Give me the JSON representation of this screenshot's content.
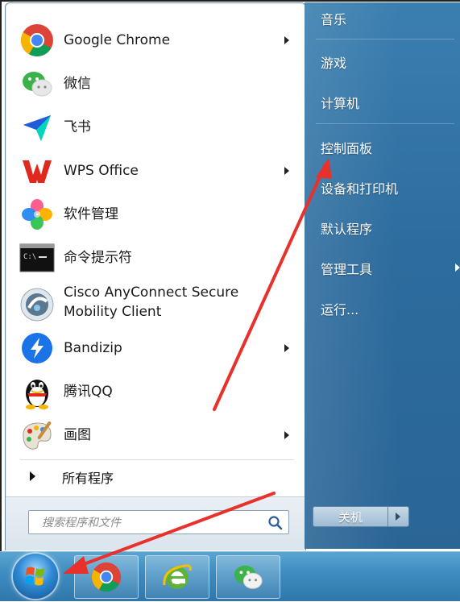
{
  "programs": [
    {
      "label": "Google Chrome",
      "icon": "chrome-icon",
      "has_submenu": true
    },
    {
      "label": "微信",
      "icon": "wechat-icon",
      "has_submenu": false
    },
    {
      "label": "飞书",
      "icon": "feishu-icon",
      "has_submenu": false
    },
    {
      "label": "WPS Office",
      "icon": "wps-icon",
      "has_submenu": true
    },
    {
      "label": "软件管理",
      "icon": "software-manager-icon",
      "has_submenu": false
    },
    {
      "label": "命令提示符",
      "icon": "cmd-icon",
      "has_submenu": false
    },
    {
      "label_line1": "Cisco AnyConnect Secure",
      "label_line2": "Mobility Client",
      "icon": "cisco-anyconnect-icon",
      "has_submenu": false
    },
    {
      "label": "Bandizip",
      "icon": "bandizip-icon",
      "has_submenu": true
    },
    {
      "label": "腾讯QQ",
      "icon": "qq-icon",
      "has_submenu": false
    },
    {
      "label": "画图",
      "icon": "paint-icon",
      "has_submenu": true
    }
  ],
  "all_programs": {
    "label": "所有程序"
  },
  "search": {
    "placeholder": "搜索程序和文件"
  },
  "right_menu": {
    "items": [
      "音乐",
      "游戏",
      "计算机",
      "控制面板",
      "设备和打印机",
      "默认程序",
      "管理工具",
      "运行..."
    ]
  },
  "shutdown": {
    "label": "关机"
  },
  "taskbar": {
    "items": [
      "start-button",
      "chrome-icon",
      "ie-icon",
      "wechat-icon"
    ]
  },
  "colors": {
    "right_panel": "#2d6c9e",
    "annotation_arrow": "#e8312a",
    "taskbar": "#3f8dc1"
  }
}
